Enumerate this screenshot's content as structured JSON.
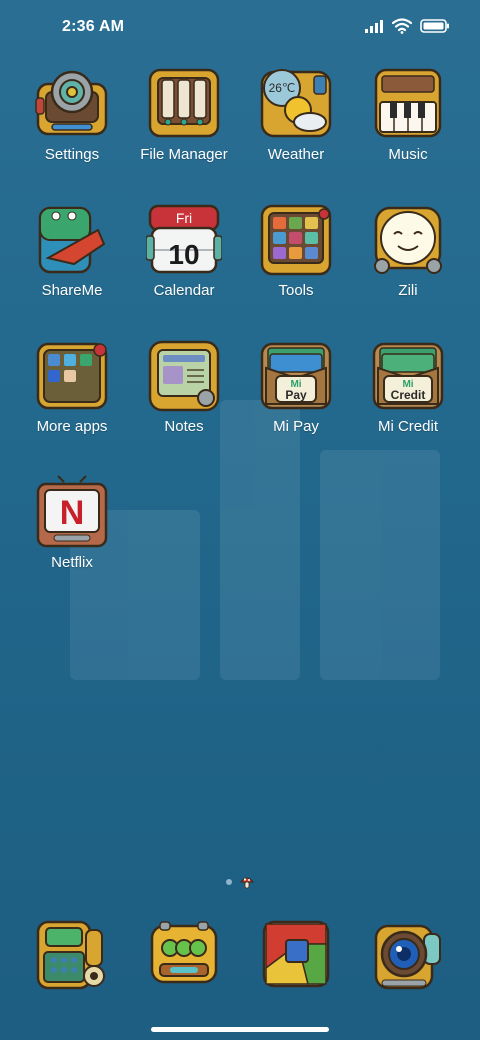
{
  "status_bar": {
    "time": "2:36 AM",
    "signal_icon": "cell-signal-icon",
    "wifi_icon": "wifi-icon",
    "battery_icon": "battery-icon"
  },
  "apps": [
    {
      "label": "Settings",
      "icon": "settings-icon"
    },
    {
      "label": "File Manager",
      "icon": "file-manager-icon"
    },
    {
      "label": "Weather",
      "icon": "weather-icon",
      "temperature": "26℃"
    },
    {
      "label": "Music",
      "icon": "music-icon"
    },
    {
      "label": "ShareMe",
      "icon": "shareme-icon"
    },
    {
      "label": "Calendar",
      "icon": "calendar-icon",
      "day": "Fri",
      "date": "10"
    },
    {
      "label": "Tools",
      "icon": "tools-icon"
    },
    {
      "label": "Zili",
      "icon": "zili-icon"
    },
    {
      "label": "More apps",
      "icon": "more-apps-icon"
    },
    {
      "label": "Notes",
      "icon": "notes-icon"
    },
    {
      "label": "Mi Pay",
      "icon": "mi-pay-icon",
      "badge_top": "Mi",
      "badge_bottom": "Pay"
    },
    {
      "label": "Mi Credit",
      "icon": "mi-credit-icon",
      "badge_top": "Mi",
      "badge_bottom": "Credit"
    },
    {
      "label": "Netflix",
      "icon": "netflix-icon",
      "letter": "N"
    }
  ],
  "dock": [
    {
      "icon": "phone-icon"
    },
    {
      "icon": "messages-icon"
    },
    {
      "icon": "chrome-icon"
    },
    {
      "icon": "camera-icon"
    }
  ],
  "page_indicator": {
    "pages": 2,
    "current": 2
  },
  "colors": {
    "background": "#23698d",
    "icon_frame": "#d9a531",
    "icon_outline": "#3a2a1a"
  }
}
